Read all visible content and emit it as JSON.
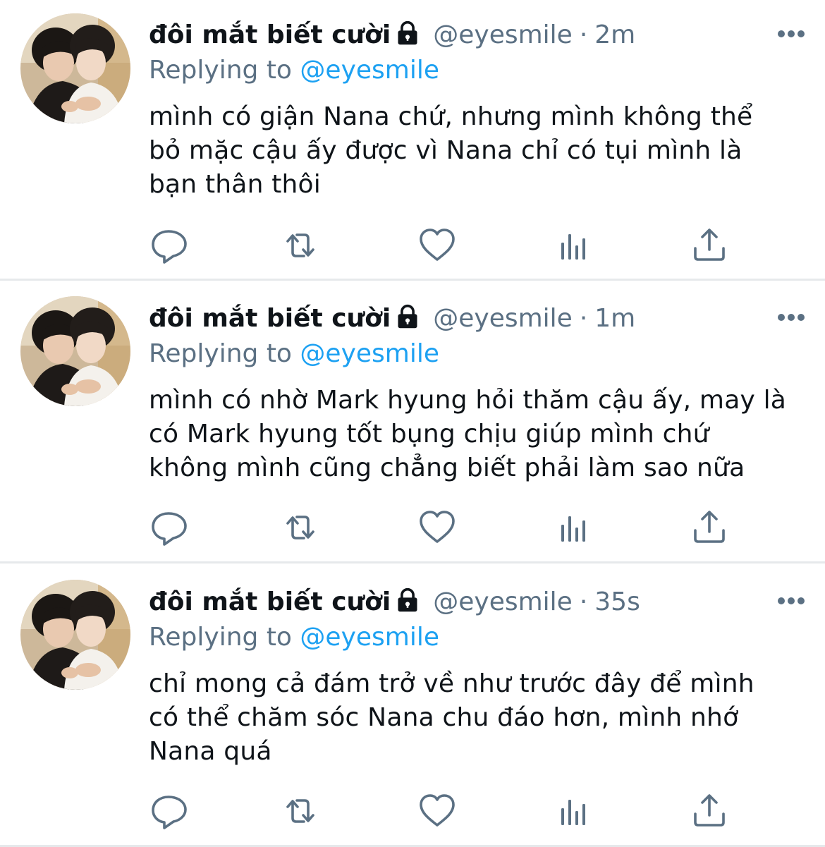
{
  "tweets": [
    {
      "display_name": "đôi mắt biết cười",
      "handle": "@eyesmile",
      "separator": "·",
      "time": "2m",
      "replying_prefix": "Replying to",
      "replying_to": "@eyesmile",
      "lines": [
        "mình có giận Nana chứ, nhưng mình không thể",
        "bỏ mặc cậu ấy được vì Nana chỉ có tụi mình là",
        "bạn thân thôi"
      ]
    },
    {
      "display_name": "đôi mắt biết cười",
      "handle": "@eyesmile",
      "separator": "·",
      "time": "1m",
      "replying_prefix": "Replying to",
      "replying_to": "@eyesmile",
      "lines": [
        "mình có nhờ Mark hyung hỏi thăm cậu ấy, may là",
        "có Mark hyung tốt bụng chịu giúp mình chứ",
        "không mình cũng chẳng biết phải làm sao nữa"
      ]
    },
    {
      "display_name": "đôi mắt biết cười",
      "handle": "@eyesmile",
      "separator": "·",
      "time": "35s",
      "replying_prefix": "Replying to",
      "replying_to": "@eyesmile",
      "lines": [
        "chỉ mong cả đám trở về như trước đây để mình",
        "có thể chăm sóc Nana chu đáo hơn, mình nhớ",
        "Nana quá"
      ]
    }
  ],
  "icons": {
    "lock": "lock-icon",
    "more": "more-options-icon",
    "reply": "reply-icon",
    "retweet": "retweet-icon",
    "like": "heart-icon",
    "analytics": "analytics-icon",
    "share": "share-icon"
  },
  "colors": {
    "text": "#0f1419",
    "secondary": "#5b7083",
    "mention": "#1da1f2",
    "icon": "#5b7083",
    "divider": "#e6e9eb"
  }
}
